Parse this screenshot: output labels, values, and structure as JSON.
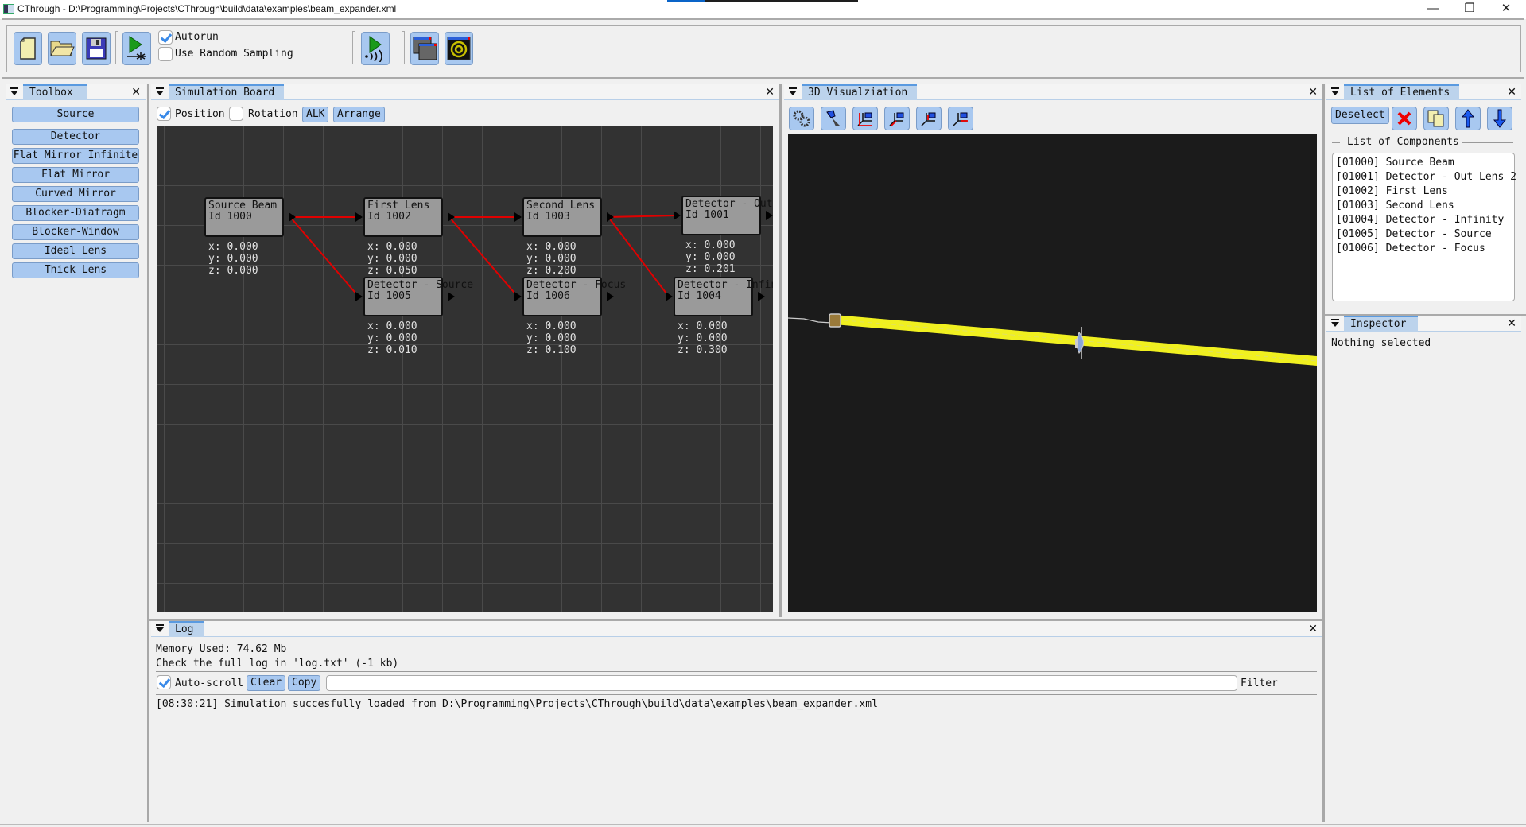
{
  "window": {
    "title": "CThrough - D:\\Programming\\Projects\\CThrough\\build\\data\\examples\\beam_expander.xml",
    "progress_fraction": 0.2,
    "controls": [
      "minimize",
      "restore",
      "close"
    ]
  },
  "toolbar": {
    "buttons": [
      {
        "name": "new-file",
        "icon": "new-file-icon"
      },
      {
        "name": "open-folder",
        "icon": "folder-open-icon"
      },
      {
        "name": "save",
        "icon": "floppy-save-icon"
      },
      {
        "name": "run-simulation",
        "icon": "play-laser-icon"
      },
      {
        "name": "run-sampling",
        "icon": "play-waves-icon"
      },
      {
        "name": "windows",
        "icon": "windows-icon"
      },
      {
        "name": "target-view",
        "icon": "target-icon"
      }
    ],
    "autorun": {
      "label": "Autorun",
      "checked": true
    },
    "random_sampling": {
      "label": "Use Random Sampling",
      "checked": false
    }
  },
  "toolbox": {
    "title": "Toolbox",
    "items": [
      "Source",
      "Detector",
      "Flat Mirror Infinite",
      "Flat Mirror",
      "Curved Mirror",
      "Blocker-Diafragm",
      "Blocker-Window",
      "Ideal Lens",
      "Thick Lens"
    ]
  },
  "board": {
    "title": "Simulation Board",
    "position": {
      "label": "Position",
      "checked": true
    },
    "rotation": {
      "label": "Rotation",
      "checked": false
    },
    "alk_label": "ALK",
    "arrange_label": "Arrange",
    "nodes": [
      {
        "name": "Source Beam",
        "id": "Id 1000",
        "x": "x: 0.000",
        "y": "y: 0.000",
        "z": "z: 0.000"
      },
      {
        "name": "First Lens",
        "id": "Id 1002",
        "x": "x: 0.000",
        "y": "y: 0.000",
        "z": "z: 0.050"
      },
      {
        "name": "Second Lens",
        "id": "Id 1003",
        "x": "x: 0.000",
        "y": "y: 0.000",
        "z": "z: 0.200"
      },
      {
        "name": "Detector - Out Lens 2",
        "id": "Id 1001",
        "x": "x: 0.000",
        "y": "y: 0.000",
        "z": "z: 0.201"
      },
      {
        "name": "Detector - Source",
        "id": "Id 1005",
        "x": "x: 0.000",
        "y": "y: 0.000",
        "z": "z: 0.010"
      },
      {
        "name": "Detector - Focus",
        "id": "Id 1006",
        "x": "x: 0.000",
        "y": "y: 0.000",
        "z": "z: 0.100"
      },
      {
        "name": "Detector - Infinity",
        "id": "Id 1004",
        "x": "x: 0.000",
        "y": "y: 0.000",
        "z": "z: 0.300"
      }
    ],
    "links": [
      [
        "Id 1000",
        "Id 1002"
      ],
      [
        "Id 1000",
        "Id 1005"
      ],
      [
        "Id 1002",
        "Id 1003"
      ],
      [
        "Id 1002",
        "Id 1006"
      ],
      [
        "Id 1003",
        "Id 1001"
      ],
      [
        "Id 1003",
        "Id 1004"
      ]
    ],
    "link_color": "#e00000"
  },
  "viz": {
    "title": "3D Visualziation",
    "tools": [
      "settings-gears-icon",
      "camera-free-icon",
      "camera-axes-icon",
      "camera-x-icon",
      "camera-y-icon",
      "camera-z-icon"
    ],
    "beam_color": "#f0f020"
  },
  "elements": {
    "title": "List of Elements",
    "deselect_label": "Deselect",
    "group_label": "List of Components",
    "items": [
      "[01000] Source Beam",
      "[01001] Detector - Out Lens 2",
      "[01002] First Lens",
      "[01003] Second Lens",
      "[01004] Detector - Infinity",
      "[01005] Detector - Source",
      "[01006] Detector - Focus"
    ]
  },
  "inspector": {
    "title": "Inspector",
    "text": "Nothing selected"
  },
  "log": {
    "title": "Log",
    "memory": "Memory Used: 74.62 Mb",
    "hint": "Check the full log in 'log.txt' (-1 kb)",
    "autoscroll": {
      "label": "Auto-scroll",
      "checked": true
    },
    "clear_label": "Clear",
    "copy_label": "Copy",
    "filter_value": "",
    "filter_label": "Filter",
    "entries": [
      "[08:30:21] Simulation succesfully loaded from D:\\Programming\\Projects\\CThrough\\build\\data\\examples\\beam_expander.xml"
    ]
  }
}
